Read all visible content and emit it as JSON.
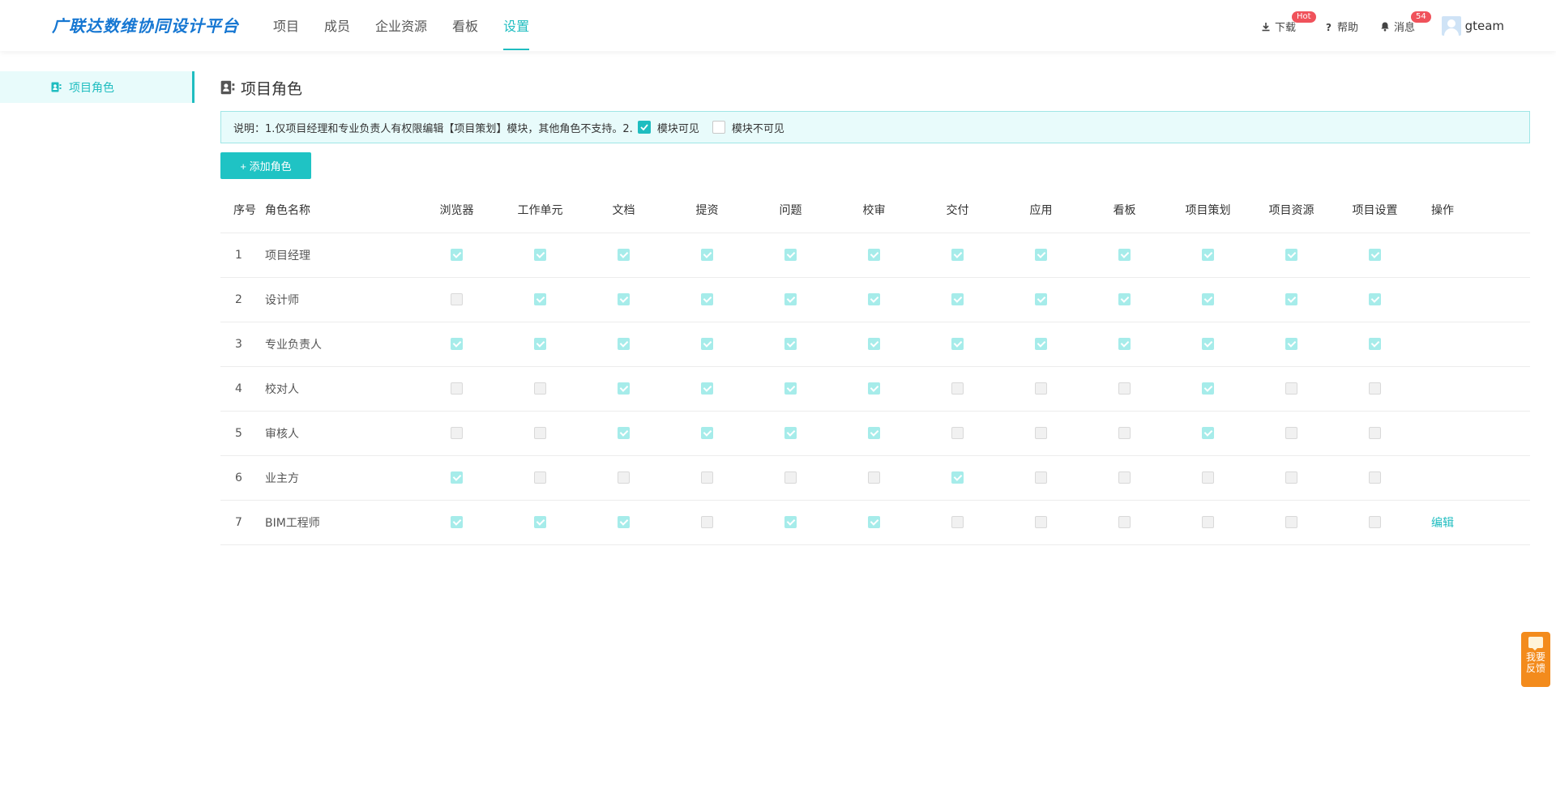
{
  "app": {
    "logo": "广联达数维协同设计平台",
    "nav": [
      {
        "label": "项目",
        "active": false
      },
      {
        "label": "成员",
        "active": false
      },
      {
        "label": "企业资源",
        "active": false
      },
      {
        "label": "看板",
        "active": false
      },
      {
        "label": "设置",
        "active": true
      }
    ],
    "tools": {
      "download_label": "下载",
      "download_badge": "Hot",
      "help_label": "帮助",
      "message_label": "消息",
      "message_badge": "54",
      "username": "gteam"
    }
  },
  "sidebar": {
    "items": [
      {
        "label": "项目角色",
        "icon": "role-card-icon",
        "active": true
      }
    ]
  },
  "page": {
    "title": "项目角色",
    "notice_text": "说明：1.仅项目经理和专业负责人有权限编辑【项目策划】模块，其他角色不支持。2.",
    "legend_visible": "模块可见",
    "legend_invisible": "模块不可见",
    "add_button": "+ 添加角色"
  },
  "table": {
    "headers": {
      "index": "序号",
      "name": "角色名称",
      "operation": "操作"
    },
    "modules": [
      "浏览器",
      "工作单元",
      "文档",
      "提资",
      "问题",
      "校审",
      "交付",
      "应用",
      "看板",
      "项目策划",
      "项目资源",
      "项目设置"
    ],
    "rows": [
      {
        "index": "1",
        "name": "项目经理",
        "perms": [
          1,
          1,
          1,
          1,
          1,
          1,
          1,
          1,
          1,
          1,
          1,
          1
        ],
        "action": ""
      },
      {
        "index": "2",
        "name": "设计师",
        "perms": [
          0,
          1,
          1,
          1,
          1,
          1,
          1,
          1,
          1,
          1,
          1,
          1
        ],
        "action": ""
      },
      {
        "index": "3",
        "name": "专业负责人",
        "perms": [
          1,
          1,
          1,
          1,
          1,
          1,
          1,
          1,
          1,
          1,
          1,
          1
        ],
        "action": ""
      },
      {
        "index": "4",
        "name": "校对人",
        "perms": [
          0,
          0,
          1,
          1,
          1,
          1,
          0,
          0,
          0,
          1,
          0,
          0
        ],
        "action": ""
      },
      {
        "index": "5",
        "name": "审核人",
        "perms": [
          0,
          0,
          1,
          1,
          1,
          1,
          0,
          0,
          0,
          1,
          0,
          0
        ],
        "action": ""
      },
      {
        "index": "6",
        "name": "业主方",
        "perms": [
          1,
          0,
          0,
          0,
          0,
          0,
          1,
          0,
          0,
          0,
          0,
          0
        ],
        "action": ""
      },
      {
        "index": "7",
        "name": "BIM工程师",
        "perms": [
          1,
          1,
          1,
          0,
          1,
          1,
          0,
          0,
          0,
          0,
          0,
          0
        ],
        "action": "编辑"
      }
    ]
  },
  "feedback": {
    "label_line1": "我要",
    "label_line2": "反馈"
  },
  "colors": {
    "accent": "#1fbdc0",
    "logo": "#1677d2",
    "badge": "#f0525b",
    "feedback": "#f38b1c",
    "checked": "#a6ecea"
  }
}
